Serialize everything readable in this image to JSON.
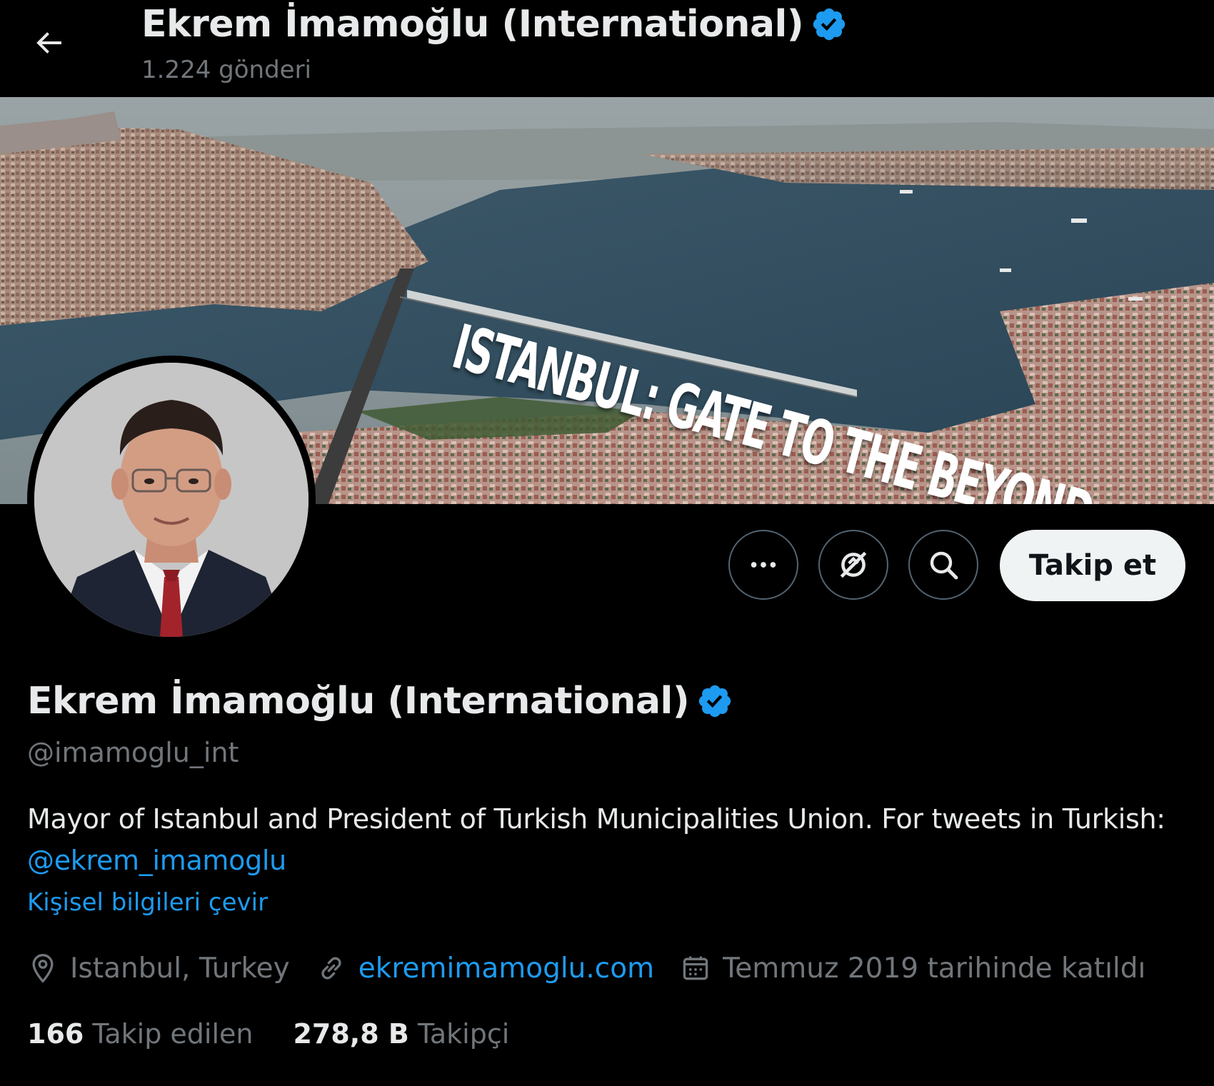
{
  "header": {
    "title": "Ekrem İmamoğlu (International)",
    "post_count": "1.224 gönderi"
  },
  "banner": {
    "text": "ISTANBUL: GATE TO THE BEYOND"
  },
  "actions": {
    "more_icon": "more-dots-icon",
    "subscribe_icon": "notification-off-icon",
    "search_icon": "search-icon",
    "follow_label": "Takip et"
  },
  "profile": {
    "name": "Ekrem İmamoğlu (International)",
    "handle": "@imamoglu_int",
    "bio_text": "Mayor of Istanbul and President of Turkish Municipalities Union. For tweets in Turkish: ",
    "bio_mention": "@ekrem_imamoglu",
    "translate_label": "Kişisel bilgileri çevir",
    "location": "Istanbul, Turkey",
    "website": "ekremimamoglu.com",
    "joined": "Temmuz 2019 tarihinde katıldı"
  },
  "stats": {
    "following_count": "166",
    "following_label": "Takip edilen",
    "followers_count": "278,8 B",
    "followers_label": "Takipçi"
  },
  "colors": {
    "background": "#000000",
    "accent": "#1d9bf0",
    "muted": "#71767b",
    "text": "#e7e9ea"
  }
}
